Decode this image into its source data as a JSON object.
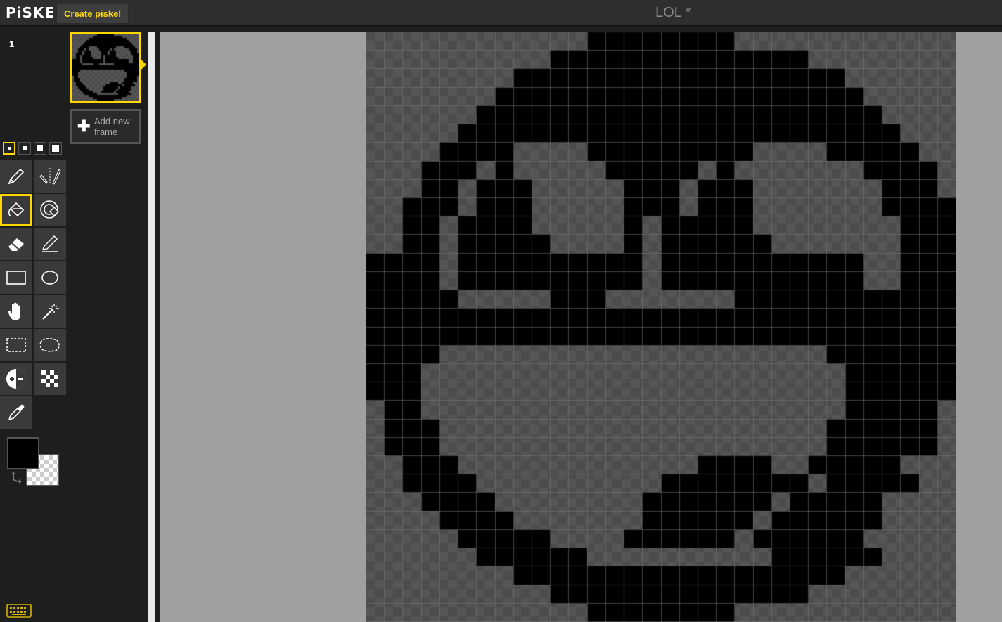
{
  "header": {
    "logo_text": "PiSKEL",
    "create_button": "Create piskel",
    "title": "LOL *"
  },
  "pen_sizes": {
    "count": 4,
    "selected_index": 0
  },
  "tools": [
    {
      "name": "pen-tool",
      "icon": "pencil-icon"
    },
    {
      "name": "vertical-mirror-pen-tool",
      "icon": "mirror-pen-icon"
    },
    {
      "name": "paint-bucket-tool",
      "icon": "paint-bucket-icon",
      "selected": true
    },
    {
      "name": "paint-all-similar-tool",
      "icon": "paint-similar-icon"
    },
    {
      "name": "eraser-tool",
      "icon": "eraser-icon"
    },
    {
      "name": "stroke-tool",
      "icon": "stroke-line-icon"
    },
    {
      "name": "rectangle-tool",
      "icon": "rectangle-icon"
    },
    {
      "name": "circle-tool",
      "icon": "circle-icon"
    },
    {
      "name": "move-tool",
      "icon": "hand-icon"
    },
    {
      "name": "shape-selection-tool",
      "icon": "magic-wand-icon"
    },
    {
      "name": "rectangle-selection-tool",
      "icon": "rectangle-selection-icon"
    },
    {
      "name": "lasso-selection-tool",
      "icon": "lasso-icon"
    },
    {
      "name": "lighten-tool",
      "icon": "lighten-darken-icon"
    },
    {
      "name": "dithering-tool",
      "icon": "checker-icon"
    },
    {
      "name": "color-picker-tool",
      "icon": "eyedropper-icon"
    }
  ],
  "colors": {
    "primary": "#000000",
    "secondary": "transparent",
    "accent": "#ffd700"
  },
  "frames": {
    "items": [
      {
        "number": "1",
        "selected": true
      }
    ],
    "add_label": "Add new frame"
  },
  "sprite": {
    "width": 32,
    "height": 32,
    "pixels": [
      "............XXXXXXXX............",
      "..........XXXXXXXXXXXXXX........",
      "........XXXXXXXXXXXXXXXXXX......",
      ".......XXXXXXXXXXXXXXXXXXXX.....",
      "......XXXXXXXXXXXXXXXXXXXXXX....",
      ".....XXXXXXXXXXXXXXXXXXXXXXXX...",
      "....XXXX....XXXXXXXXX....XXXXX..",
      "...XXX.X.....XXXXX.X.......XXXX.",
      "...XX.XXX.....XXX.XXX.......XXX.",
      "..XXX.XXX.....XXX.XXX.......XXXX",
      "..XX.XXXX.....X.XXXXX........XXX",
      "..XX.XXXXX....X.XXXXXX.......XXX",
      "XXXX.XXXXXXXXXX.XXXXXXXXXXX..XXXX",
      "XXXX.XXXXXXXXXX.XXXXXXXXXXX..XXXX",
      "XXXXX.....XXX.......XXXXXXXXXXXX",
      "XXXXXXXXXXXXXXXXXXXXXXXXXXXXXXXX",
      "XXXXXXXXXXXXXXXXXXXXXXXXXXXXXXXX",
      "XXXX.....................XXXXXXX",
      "XXX.......................XXXXXX",
      "XXX.......................XXXXXX",
      ".XX.......................XXXXX.",
      ".XXX.....................XXXXXX.",
      ".XXX.....................XXXXXX.",
      "..XXX.............XXXX..XXXXX...",
      "..XXXX..........XXXXXXXX.XXXXX..",
      "...XXXX........XXXXXXX.XXXXX....",
      "....XXXX.......XXXXXX.XXXXXX....",
      ".....XXXXX....XXXXXX.XXXXXX.....",
      "......XXXXXX..........XXXXXX....",
      "........XXXXXXXXXXXXXXXXXX......",
      "..........XXXXXXXXXXXXXX........",
      "............XXXXXXXX............"
    ]
  }
}
